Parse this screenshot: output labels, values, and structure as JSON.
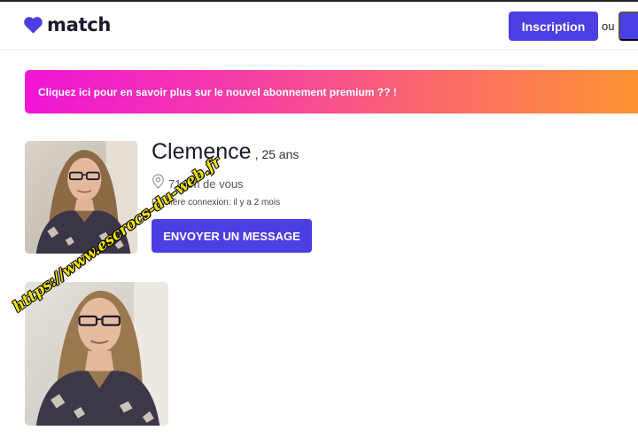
{
  "header": {
    "logo_text": "match",
    "signup_label": "Inscription",
    "or_text": "ou"
  },
  "banner": {
    "text": "Cliquez ici pour en savoir plus sur le nouvel abonnement premium ?? !"
  },
  "profile": {
    "name": "Clemence",
    "age": ", 25 ans",
    "distance": "71 km de vous",
    "last_seen": "Dernière connexion: il y a 2 mois",
    "message_button": "ENVOYER UN MESSAGE"
  },
  "watermark": {
    "text": "https://www.escrocs-du-web.fr"
  },
  "colors": {
    "brand": "#4b3fe3",
    "banner_start": "#f014d6",
    "banner_end": "#fd9a2c"
  },
  "icons": {
    "logo": "heart-icon",
    "location": "location-pin-icon"
  }
}
